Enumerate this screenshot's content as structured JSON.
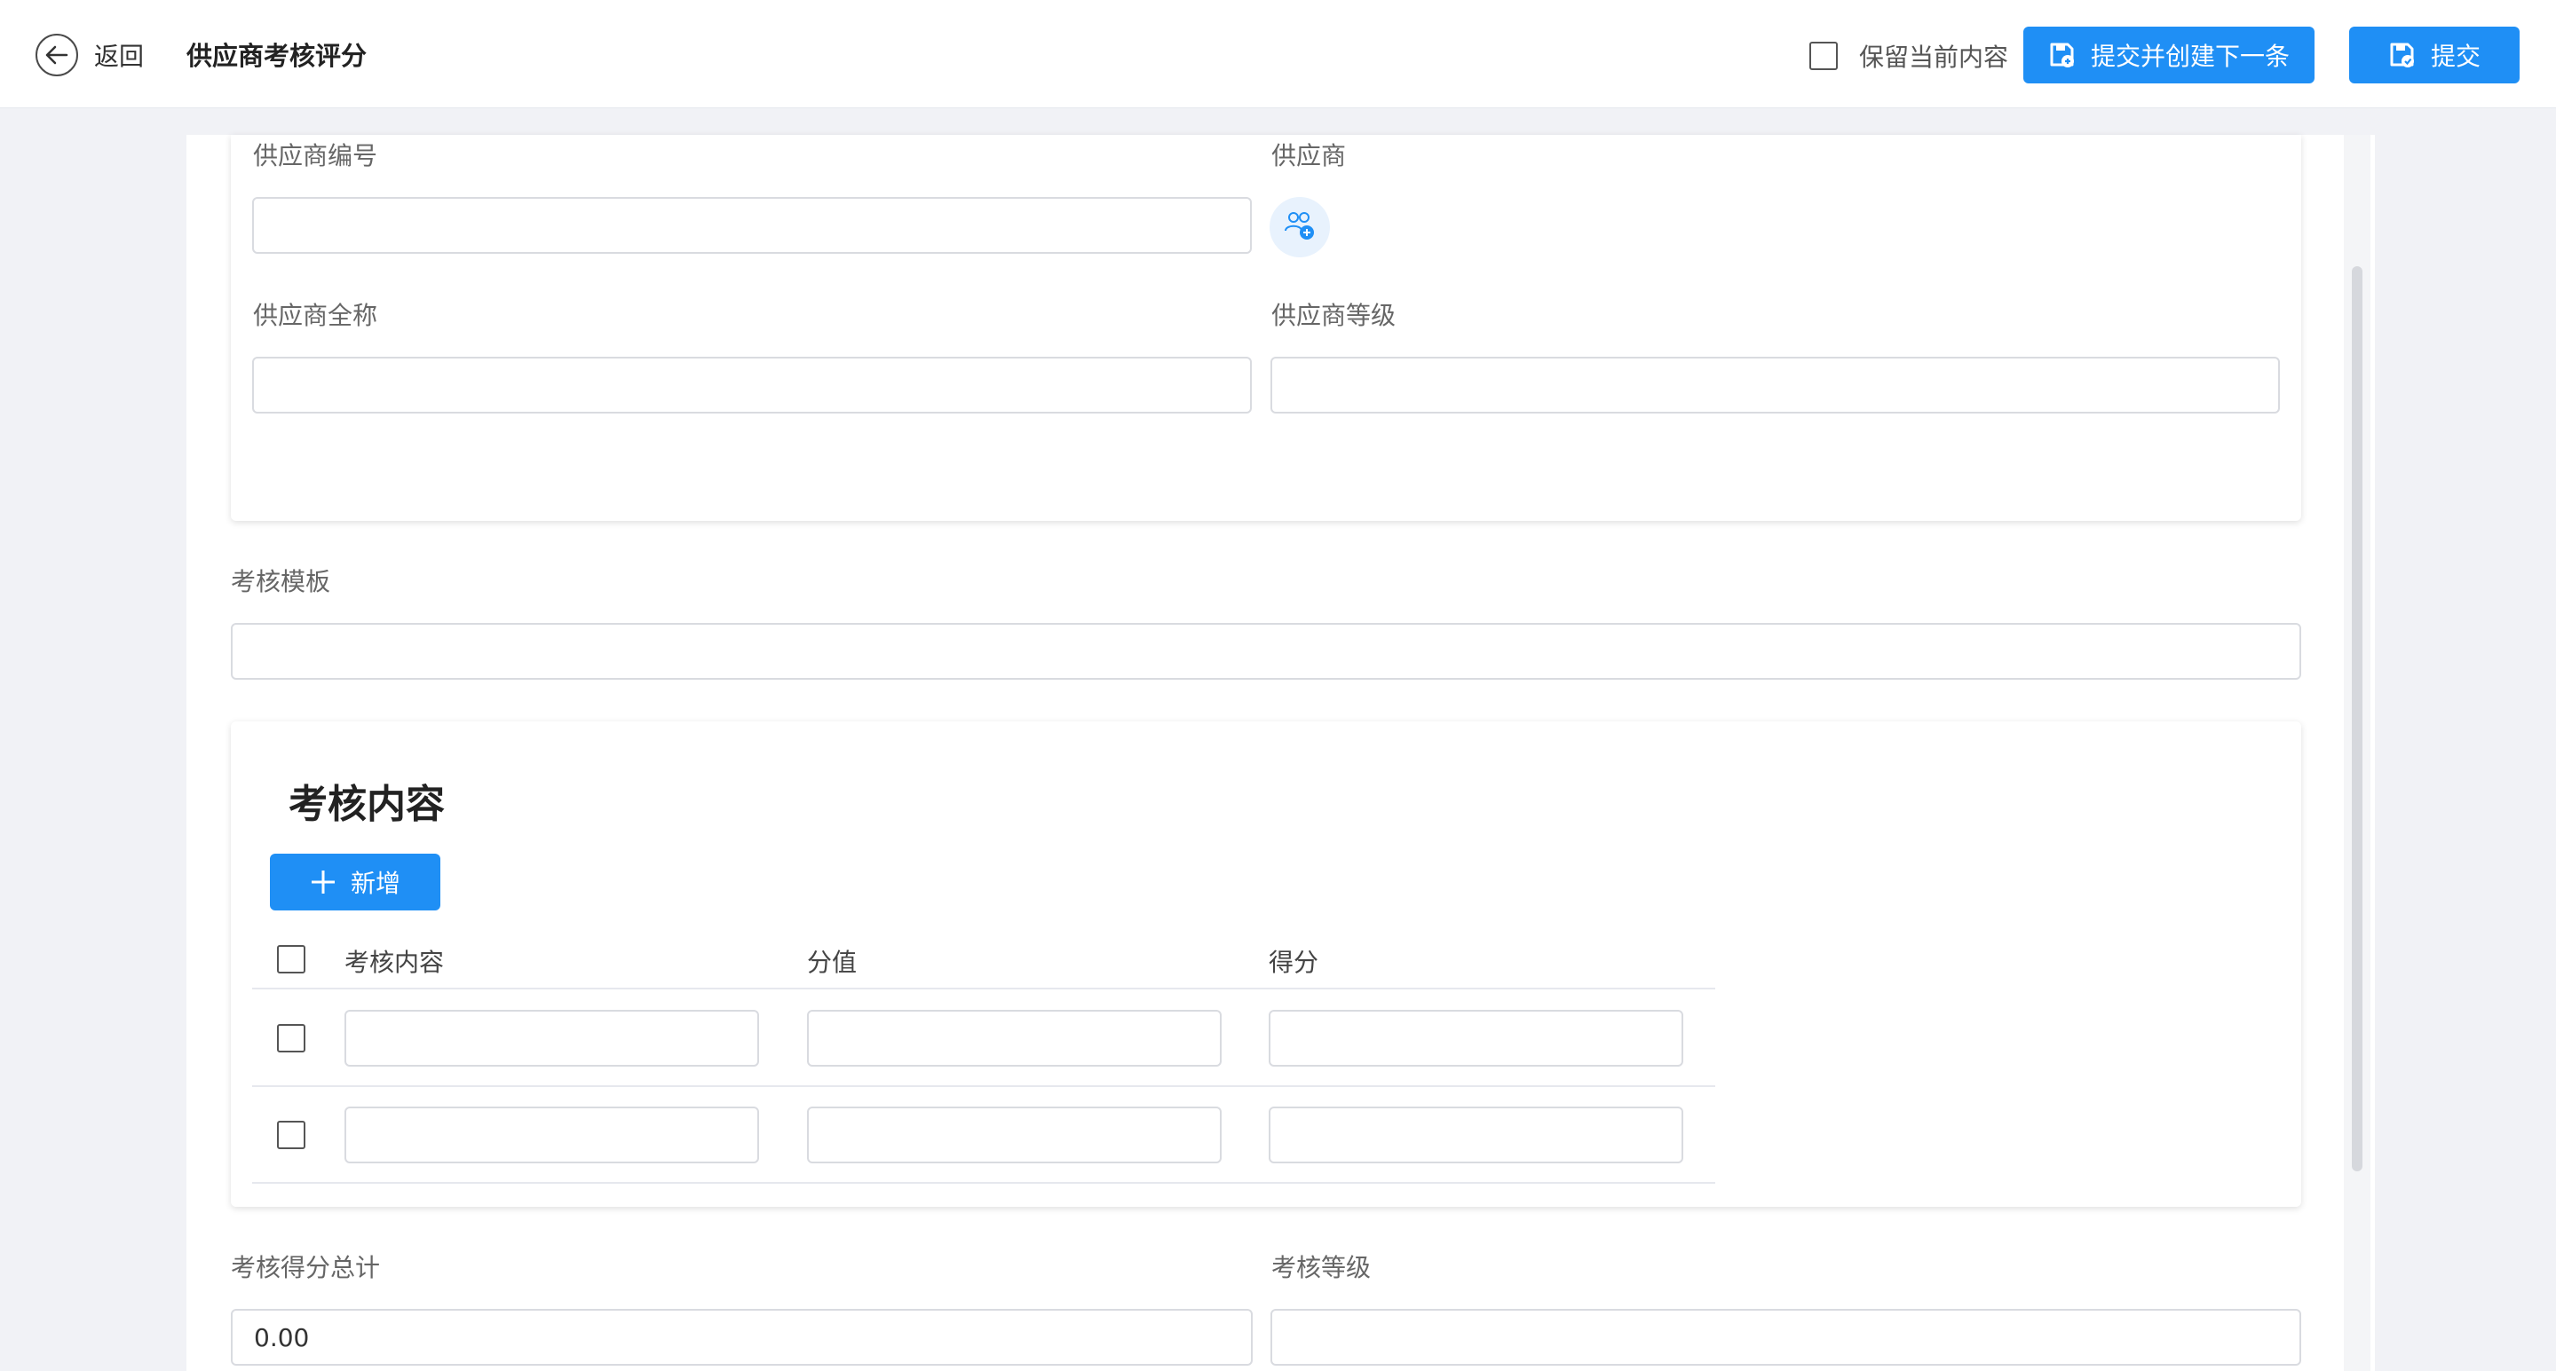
{
  "header": {
    "back_label": "返回",
    "title": "供应商考核评分",
    "keep_label": "保留当前内容",
    "submit_next_label": "提交并创建下一条",
    "submit_label": "提交"
  },
  "form": {
    "supplier_code": {
      "label": "供应商编号",
      "value": ""
    },
    "supplier": {
      "label": "供应商"
    },
    "supplier_fullname": {
      "label": "供应商全称",
      "value": ""
    },
    "supplier_level": {
      "label": "供应商等级",
      "value": ""
    },
    "template": {
      "label": "考核模板",
      "value": ""
    },
    "total_score": {
      "label": "考核得分总计",
      "value": "0.00"
    },
    "assess_level": {
      "label": "考核等级",
      "value": ""
    }
  },
  "assessment": {
    "title": "考核内容",
    "add_label": "新增",
    "columns": [
      "考核内容",
      "分值",
      "得分"
    ],
    "rows": [
      {
        "content": "",
        "score_value": "",
        "score": ""
      },
      {
        "content": "",
        "score_value": "",
        "score": ""
      }
    ]
  },
  "colors": {
    "primary": "#1f8ff5",
    "background": "#f1f2f6"
  }
}
